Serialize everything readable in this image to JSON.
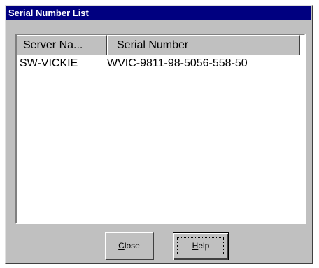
{
  "dialog": {
    "title": "Serial Number List"
  },
  "list": {
    "columns": [
      {
        "label": "Server Na..."
      },
      {
        "label": "Serial Number"
      }
    ],
    "rows": [
      {
        "server": "SW-VICKIE",
        "serial": "WVIC-9811-98-5056-558-50"
      }
    ]
  },
  "buttons": {
    "close": {
      "mnemonic": "C",
      "rest": "lose"
    },
    "help": {
      "mnemonic": "H",
      "rest": "elp"
    }
  }
}
